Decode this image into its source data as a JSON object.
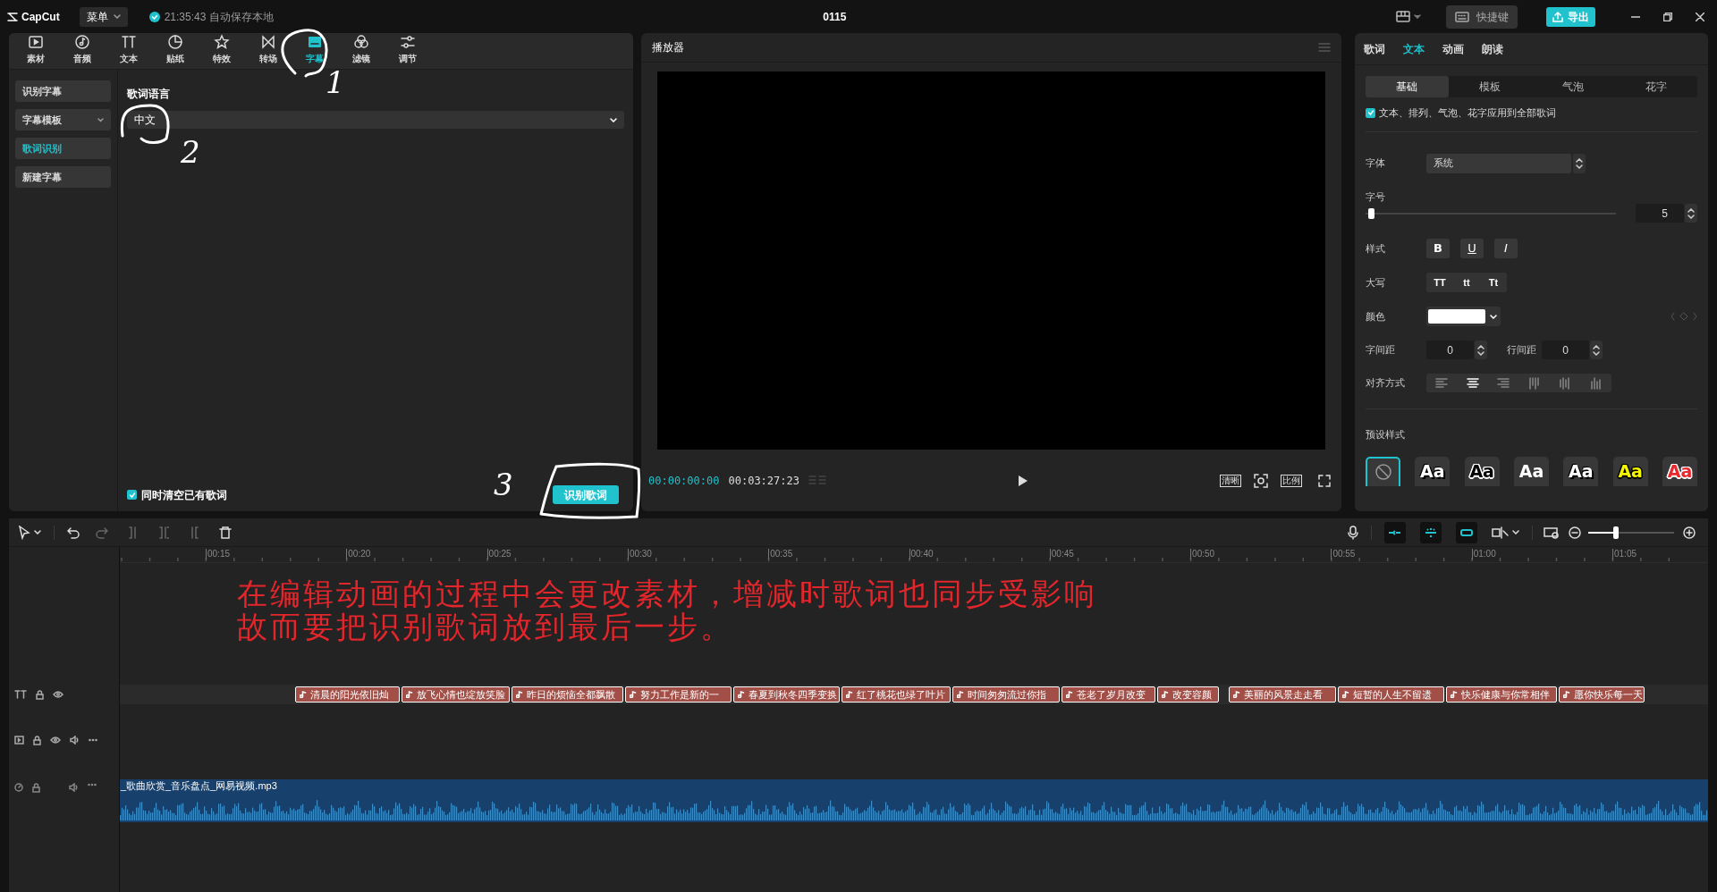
{
  "top_bar": {
    "logo": "CapCut",
    "menu": "菜单",
    "save_status": "21:35:43 自动保存本地",
    "project_title": "0115",
    "shortcut_button": "快捷键",
    "export_button": "导出"
  },
  "toolbar_tabs": [
    {
      "label": "素材",
      "selected": false
    },
    {
      "label": "音频",
      "selected": false
    },
    {
      "label": "文本",
      "selected": false
    },
    {
      "label": "贴纸",
      "selected": false
    },
    {
      "label": "特效",
      "selected": false
    },
    {
      "label": "转场",
      "selected": false
    },
    {
      "label": "字幕",
      "selected": true
    },
    {
      "label": "滤镜",
      "selected": false
    },
    {
      "label": "调节",
      "selected": false
    }
  ],
  "side_menu": [
    {
      "label": "识别字幕",
      "selected": false
    },
    {
      "label": "字幕模板",
      "selected": false,
      "dropdown": true
    },
    {
      "label": "歌词识别",
      "selected": true
    },
    {
      "label": "新建字幕",
      "selected": false
    }
  ],
  "lyrics_panel": {
    "heading": "歌词语言",
    "language": "中文",
    "clear_existing": {
      "label": "同时清空已有歌词",
      "checked": true
    },
    "recognize_button": "识别歌词"
  },
  "player": {
    "title": "播放器",
    "current_time": "00:00:00:00",
    "total_time": "00:03:27:23",
    "quality_button": "清晰",
    "ratio_button": "比例"
  },
  "inspector": {
    "tabs": [
      {
        "label": "歌词",
        "selected": false
      },
      {
        "label": "文本",
        "selected": true
      },
      {
        "label": "动画",
        "selected": false
      },
      {
        "label": "朗读",
        "selected": false
      }
    ],
    "subtabs": [
      {
        "label": "基础",
        "selected": true
      },
      {
        "label": "模板",
        "selected": false
      },
      {
        "label": "气泡",
        "selected": false
      },
      {
        "label": "花字",
        "selected": false
      }
    ],
    "apply_all": {
      "label": "文本、排列、气泡、花字应用到全部歌词",
      "checked": true
    },
    "font_label": "字体",
    "font_value": "系统",
    "size_label": "字号",
    "size_value": "5",
    "size_slider": {
      "level": 0.01
    },
    "style_label": "样式",
    "style_buttons": [
      "B",
      "U",
      "I"
    ],
    "case_label": "大写",
    "case_buttons": [
      "TT",
      "tt",
      "Tt"
    ],
    "color_label": "颜色",
    "color": "#ffffff",
    "letter_spacing_label": "字间距",
    "letter_spacing": "0",
    "line_spacing_label": "行间距",
    "line_spacing": "0",
    "align_label": "对齐方式",
    "presets_label": "预设样式",
    "presets": [
      {
        "kind": "none",
        "selected": true
      },
      {
        "kind": "shadow",
        "label": "Aa",
        "color": "#ffffff",
        "selected": false
      },
      {
        "kind": "outline",
        "label": "Aa",
        "color": "#000000",
        "selected": false
      },
      {
        "kind": "plain",
        "label": "Aa",
        "color": "#ffffff",
        "selected": false
      },
      {
        "kind": "shadow",
        "label": "Aa",
        "color": "#ffffff",
        "selected": false
      },
      {
        "kind": "outline",
        "label": "Aa",
        "color": "#f5f500",
        "selected": false
      },
      {
        "kind": "outline",
        "label": "Aa",
        "color": "#e8282d",
        "selected": false
      }
    ]
  },
  "timeline": {
    "zoom_slider": {
      "level": 0.32
    },
    "ruler": [
      "00:15",
      "00:20",
      "00:25",
      "00:30",
      "00:35",
      "00:40",
      "00:45",
      "00:50",
      "00:55",
      "01:00",
      "01:05"
    ],
    "lyric_clips": [
      "清晨的阳光依旧灿",
      "放飞心情也绽放笑脸",
      "昨日的烦恼全都飘散",
      "努力工作是新的一",
      "春夏到秋冬四季变换",
      "红了桃花也绿了叶片",
      "时间匆匆流过你指",
      "苍老了岁月改变",
      "改变容颜",
      "美丽的风景走走看",
      "短暂的人生不留遗",
      "快乐健康与你常相伴",
      "愿你快乐每一天"
    ],
    "audio_clip": "_歌曲欣赏_音乐盘点_网易视频.mp3"
  },
  "annotation": {
    "lines": [
      "在编辑动画的过程中会更改素材，增减时歌词也同步受影响",
      "故而要把识别歌词放到最后一步。"
    ],
    "marks": [
      "1",
      "2",
      "3"
    ]
  }
}
